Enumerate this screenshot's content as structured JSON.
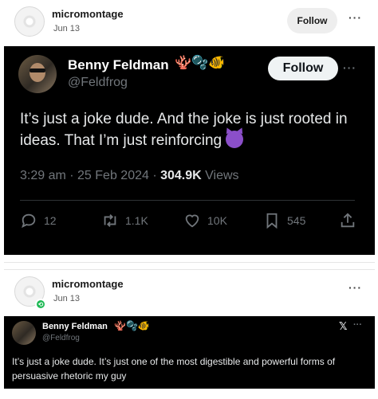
{
  "posts": [
    {
      "poster": {
        "name": "micromontage",
        "date": "Jun 13"
      },
      "follow_label": "Follow",
      "more": "···",
      "tweet": {
        "name": "Benny Feldman",
        "name_emoji": "🪸🫧🐠",
        "handle": "@Feldfrog",
        "follow_label": "Follow",
        "more": "···",
        "text": "It’s just a joke dude. And the joke is just rooted in ideas. That I’m just reinforcing",
        "time": "3:29 am · 25 Feb 2024 · ",
        "views_count": "304.9K",
        "views_label": " Views",
        "actions": {
          "replies": "12",
          "reposts": "1.1K",
          "likes": "10K",
          "bookmarks": "545"
        }
      }
    },
    {
      "poster": {
        "name": "micromontage",
        "date": "Jun 13",
        "repost_icon": "repost-icon"
      },
      "more": "···",
      "tweet": {
        "name": "Benny Feldman",
        "name_emoji": "🪸🫧🐠",
        "handle": "@Feldfrog",
        "logo": "𝕏",
        "more": "···",
        "text": "It’s just a joke dude. It’s just one of the most digestible and powerful forms of persuasive rhetoric my guy"
      }
    }
  ]
}
